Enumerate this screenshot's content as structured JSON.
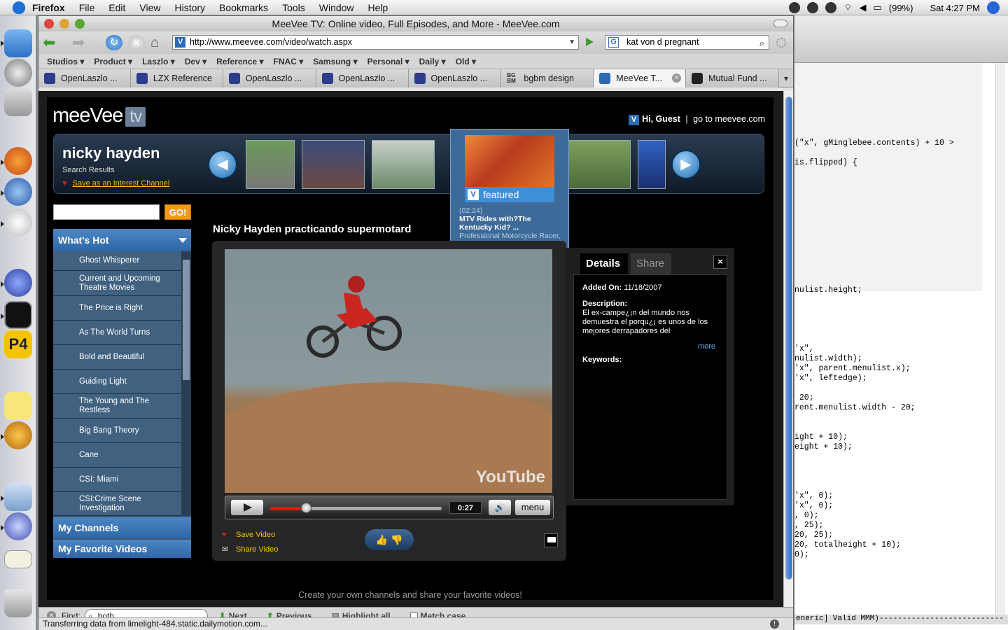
{
  "menubar": {
    "items": [
      "Firefox",
      "File",
      "Edit",
      "View",
      "History",
      "Bookmarks",
      "Tools",
      "Window",
      "Help"
    ],
    "battery": "(99%)",
    "clock": "Sat 4:27 PM"
  },
  "window": {
    "title": "MeeVee TV: Online video, Full Episodes, and More - MeeVee.com"
  },
  "nav": {
    "url": "http://www.meevee.com/video/watch.aspx",
    "search_value": "kat von d pregnant",
    "url_favicon": "V",
    "search_engine_glyph": "G"
  },
  "bookmarks": [
    "Studios ▾",
    "Product ▾",
    "Laszlo ▾",
    "Dev ▾",
    "Reference ▾",
    "FNAC ▾",
    "Samsung ▾",
    "Personal ▾",
    "Daily ▾",
    "Old ▾"
  ],
  "tabs": [
    "OpenLaszlo ...",
    "LZX Reference",
    "OpenLaszlo ...",
    "OpenLaszlo ...",
    "OpenLaszlo ...",
    "bgbm design",
    "MeeVee T...",
    "Mutual Fund ..."
  ],
  "tab_bgbm_icon": "BG BM",
  "page": {
    "logo": "meeVee",
    "logo_tv": "tv",
    "guest": "Hi, Guest",
    "guest_sep": "|",
    "goto": "go to meevee.com",
    "banner_name": "nicky hayden",
    "banner_sub": "Search Results",
    "banner_save": "Save as an Interest Channel",
    "featured_label": "featured",
    "featured_duration": "(02:24)",
    "featured_title": "MTV Rides with?The Kentucky Kid? ...",
    "featured_desc": "Professional Motorcycle Racer, Nicky Hayden Gives",
    "go_button": "GO!",
    "whats_hot": "What's Hot",
    "hot_items": [
      "Ghost Whisperer",
      "Current and Upcoming Theatre Movies",
      "The Price is Right",
      "As The World Turns",
      "Bold and Beautiful",
      "Guiding Light",
      "The Young and The Restless",
      "Big Bang Theory",
      "Cane",
      "CSI: Miami",
      "CSI:Crime Scene Investigation"
    ],
    "my_channels": "My Channels",
    "my_favorites": "My Favorite Videos",
    "video_title": "Nicky Hayden practicando supermotard",
    "player_watermark": "YouTube",
    "player_time": "0:27",
    "player_menu": "menu",
    "player_progress": 0.21,
    "save_video": "Save Video",
    "share_video": "Share Video",
    "details_tab": "Details",
    "share_tab": "Share",
    "added_label": "Added On:",
    "added_value": "11/18/2007",
    "desc_label": "Description:",
    "desc_value": "El ex-campe¿¡n del mundo nos demuestra el porqu¿¡ es unos de los mejores derrapadores del",
    "more": "more",
    "keywords_label": "Keywords:",
    "tagline": "Create your own channels and share your favorite videos!"
  },
  "find": {
    "label": "Find:",
    "value": "both",
    "next": "Next",
    "previous": "Previous",
    "highlight": "Highlight all",
    "match": "Match case"
  },
  "status": "Transferring data from limelight-484.static.dailymotion.com...",
  "bg_code": {
    "top": "(\"x\", gMinglebee.contents) + 10 >\n\nis.flipped) {",
    "mid": "nulist.height;\n\n\n\n\n\n'x\",\nnulist.width);\n'x\", parent.menulist.x);\n'x\", leftedge);\n\n 20;\nrent.menulist.width - 20;\n\n\night + 10);\neight + 10);\n\n\n\n\n'x\", 0);\n'x\", 0);\n, 0);\n, 25);\n20, 25);\n20, totalheight + 10);\n0);",
    "status": "eneric] Valid MMM)---------------------------"
  },
  "colors": {
    "accent": "#2f67a6",
    "go": "#f29a16",
    "link": "#f5c400"
  }
}
